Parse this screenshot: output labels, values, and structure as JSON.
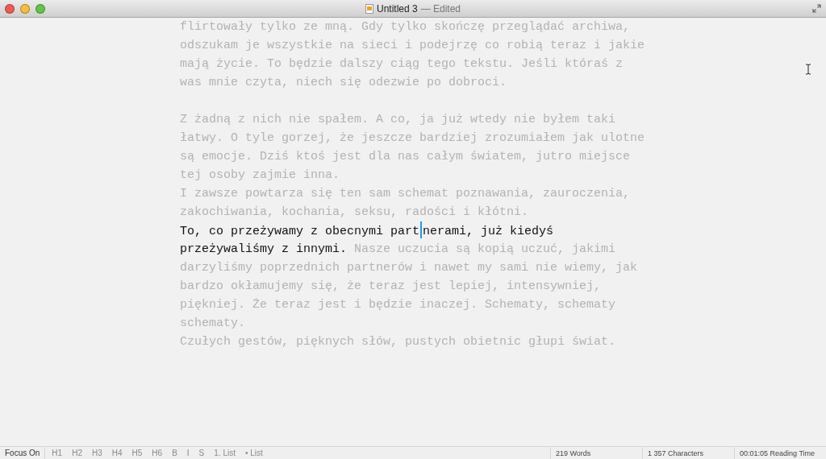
{
  "window": {
    "title": "Untitled 3",
    "subtitle": "— Edited"
  },
  "editor": {
    "lines": [
      {
        "kind": "text",
        "segments": [
          {
            "text": "flirtowały tylko ze mną. Gdy tylko skończę przeglądać archiwa,",
            "focused": false
          }
        ]
      },
      {
        "kind": "text",
        "segments": [
          {
            "text": "odszukam je wszystkie na sieci i podejrzę co robią teraz i jakie",
            "focused": false
          }
        ]
      },
      {
        "kind": "text",
        "segments": [
          {
            "text": "mają życie. To będzie dalszy ciąg tego tekstu. Jeśli któraś z",
            "focused": false
          }
        ]
      },
      {
        "kind": "text",
        "segments": [
          {
            "text": "was mnie czyta, niech się odezwie po dobroci.",
            "focused": false
          }
        ]
      },
      {
        "kind": "blank"
      },
      {
        "kind": "text",
        "segments": [
          {
            "text": "Z żadną z nich nie spałem. A co, ja już wtedy nie byłem taki",
            "focused": false
          }
        ]
      },
      {
        "kind": "text",
        "segments": [
          {
            "text": "łatwy. O tyle gorzej, że jeszcze bardziej zrozumiałem jak ulotne",
            "focused": false
          }
        ]
      },
      {
        "kind": "text",
        "segments": [
          {
            "text": "są emocje. Dziś ktoś jest dla nas całym światem, jutro miejsce",
            "focused": false
          }
        ]
      },
      {
        "kind": "text",
        "segments": [
          {
            "text": "tej osoby zajmie inna.",
            "focused": false
          }
        ]
      },
      {
        "kind": "text",
        "segments": [
          {
            "text": "I zawsze powtarza się ten sam schemat poznawania, zauroczenia,",
            "focused": false
          }
        ]
      },
      {
        "kind": "text",
        "segments": [
          {
            "text": "zakochiwania, kochania, seksu, radości i kłótni.",
            "focused": false
          }
        ]
      },
      {
        "kind": "text",
        "segments": [
          {
            "text": "To, co przeżywamy z obecnymi part",
            "focused": true,
            "caret_after": true
          },
          {
            "text": "nerami, już kiedyś",
            "focused": true
          }
        ]
      },
      {
        "kind": "text",
        "segments": [
          {
            "text": "przeżywaliśmy z innymi.",
            "focused": true
          },
          {
            "text": " Nasze uczucia są kopią uczuć, jakimi",
            "focused": false
          }
        ]
      },
      {
        "kind": "text",
        "segments": [
          {
            "text": "darzyliśmy poprzednich partnerów i nawet my sami nie wiemy, jak",
            "focused": false
          }
        ]
      },
      {
        "kind": "text",
        "segments": [
          {
            "text": "bardzo okłamujemy się, że teraz jest lepiej, intensywniej,",
            "focused": false
          }
        ]
      },
      {
        "kind": "text",
        "segments": [
          {
            "text": "piękniej. Że teraz jest i będzie inaczej. Schematy, schematy",
            "focused": false
          }
        ]
      },
      {
        "kind": "text",
        "segments": [
          {
            "text": "schematy.",
            "focused": false
          }
        ]
      },
      {
        "kind": "text",
        "segments": [
          {
            "text": "Czułych gestów, pięknych słów, pustych obietnic głupi świat.",
            "focused": false
          }
        ]
      }
    ]
  },
  "status_bar": {
    "focus_button": {
      "label": "Focus On",
      "disabled": false
    },
    "format_buttons": [
      {
        "label": "H1",
        "disabled": true
      },
      {
        "label": "H2",
        "disabled": true
      },
      {
        "label": "H3",
        "disabled": true
      },
      {
        "label": "H4",
        "disabled": true
      },
      {
        "label": "H5",
        "disabled": true
      },
      {
        "label": "H6",
        "disabled": true
      },
      {
        "label": "B",
        "disabled": true
      },
      {
        "label": "I",
        "disabled": true
      },
      {
        "label": "S",
        "disabled": true
      },
      {
        "label": "1. List",
        "disabled": true
      },
      {
        "label": "• List",
        "disabled": true
      }
    ],
    "stats": [
      "219 Words",
      "1 357 Characters",
      "00:01:05 Reading Time"
    ]
  }
}
